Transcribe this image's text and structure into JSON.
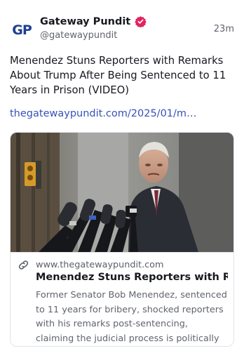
{
  "author": {
    "avatar_text": "GP",
    "display_name": "Gateway Pundit",
    "handle": "@gatewaypundit",
    "verified_icon": "verified-badge-icon",
    "timestamp": "23m"
  },
  "post": {
    "text": "Menendez Stuns Reporters with Remarks About Trump After Being Sentenced to 11 Years in Prison (VIDEO)",
    "link": "thegatewaypundit.com/2025/01/m…"
  },
  "link_card": {
    "image_alt": "Bob Menendez speaking to reporters at a cluster of microphones outside a courthouse",
    "link_icon": "link-icon",
    "domain": "www.thegatewaypundit.com",
    "title": "Menendez Stuns Reporters with Rem…",
    "description": "Former Senator Bob Menendez, sentenced to 11 years for bribery, shocked reporters with his remarks post-sentencing, claiming the judicial process is politically corrupted. Rea…"
  },
  "colors": {
    "brand": "#1f3f93",
    "verified": "#e0245e",
    "link": "#3652b8",
    "muted": "#60646c"
  }
}
